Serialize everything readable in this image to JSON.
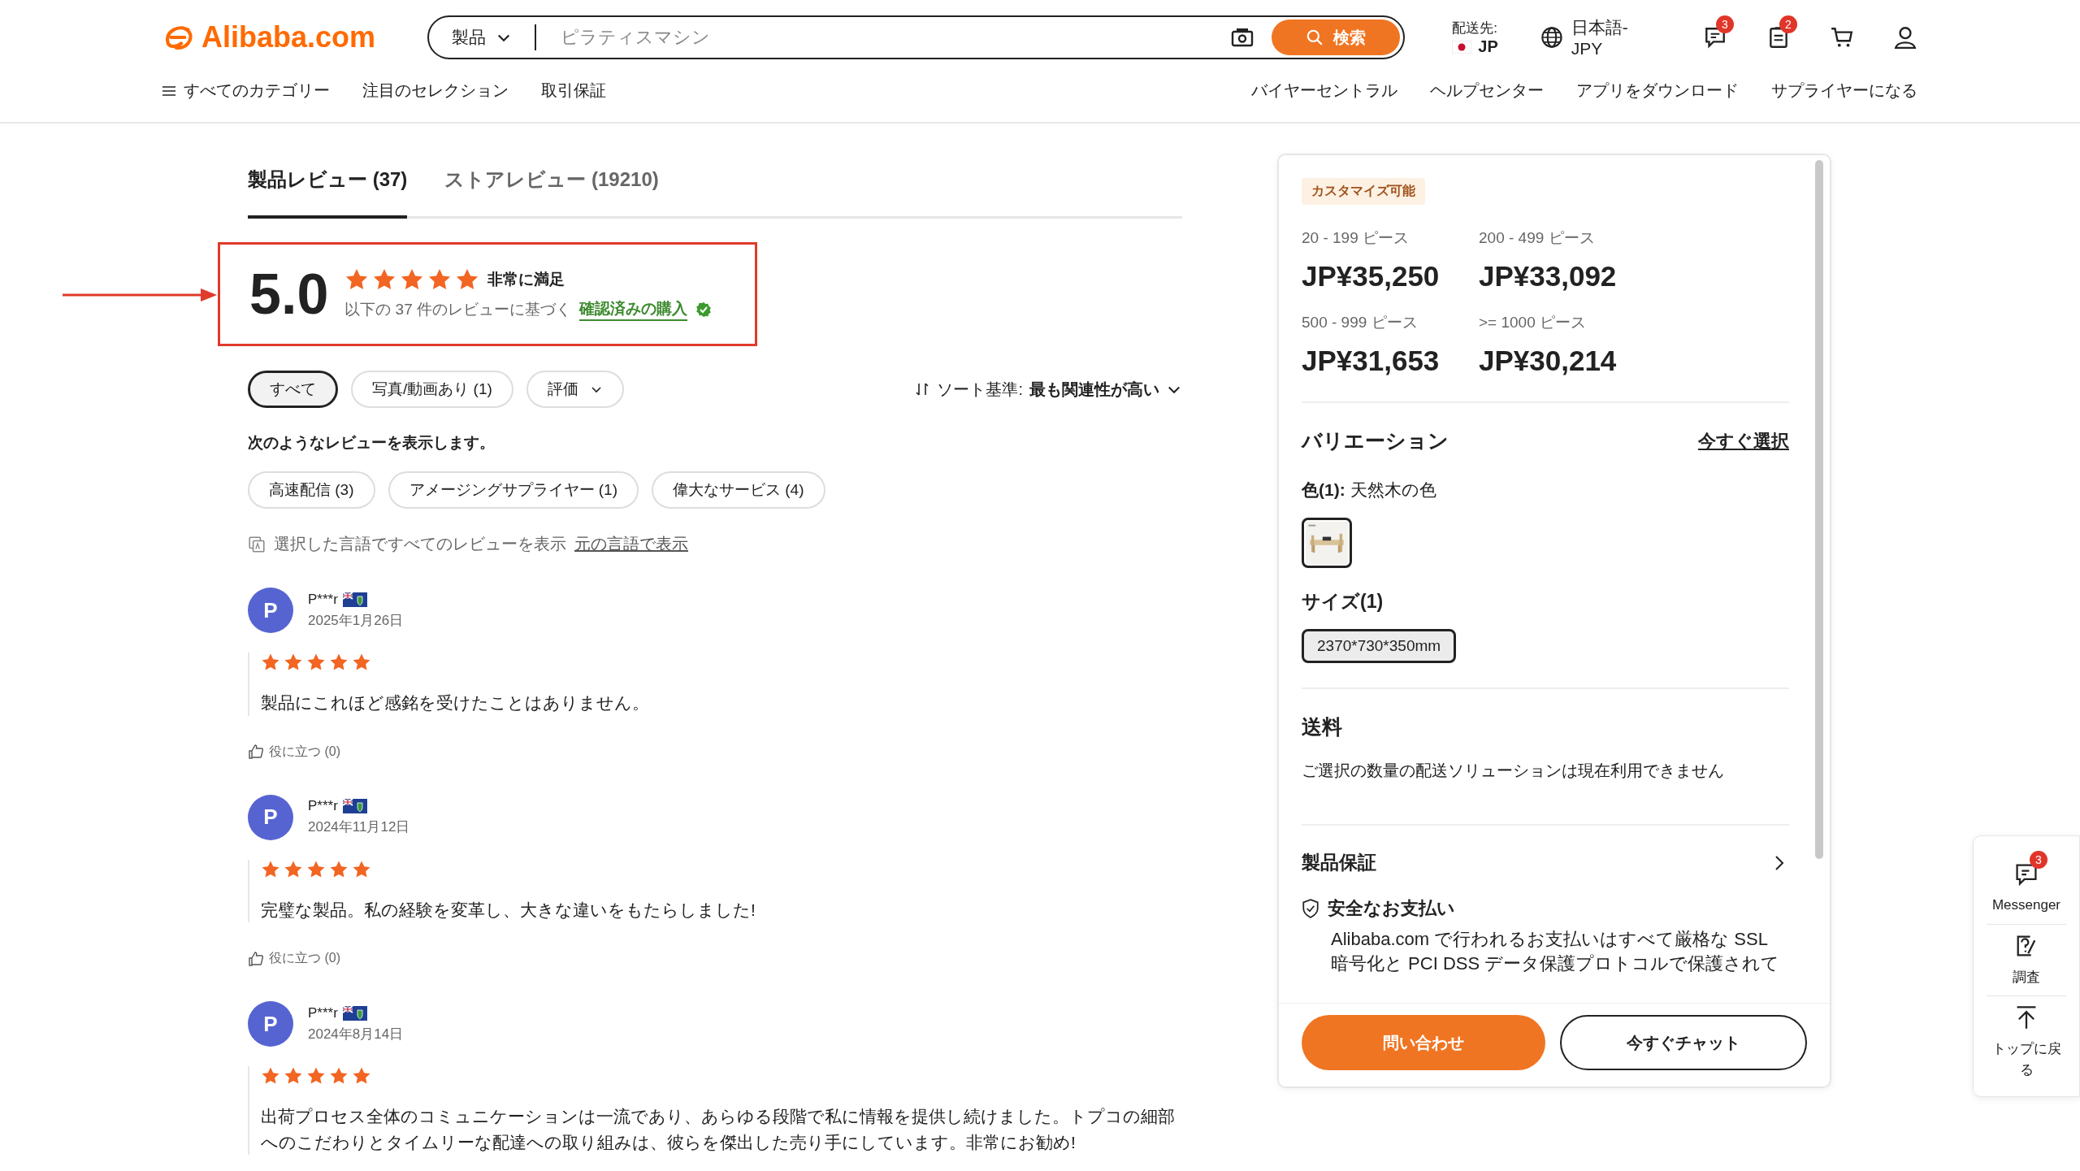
{
  "header": {
    "logo": "Alibaba.com",
    "search": {
      "category": "製品",
      "placeholder": "ピラティスマシン",
      "button": "検索"
    },
    "ship_to": {
      "label": "配送先:",
      "country": "JP"
    },
    "language": "日本語-JPY",
    "message_badge": "3",
    "orders_badge": "2"
  },
  "nav_left": [
    "すべてのカテゴリー",
    "注目のセレクション",
    "取引保証"
  ],
  "nav_right": [
    "バイヤーセントラル",
    "ヘルプセンター",
    "アプリをダウンロード",
    "サプライヤーになる"
  ],
  "tabs": [
    {
      "label": "製品レビュー (37)",
      "selected": true
    },
    {
      "label": "ストアレビュー (19210)",
      "selected": false
    }
  ],
  "rating_summary": {
    "score": "5.0",
    "stars": 5,
    "label": "非常に満足",
    "basis": "以下の 37 件のレビューに基づく",
    "verified": "確認済みの購入"
  },
  "filters": [
    {
      "label": "すべて",
      "selected": true,
      "kind": "chip"
    },
    {
      "label": "写真/動画あり (1)",
      "selected": false,
      "kind": "chip"
    },
    {
      "label": "評価",
      "selected": false,
      "kind": "dropdown"
    }
  ],
  "sort": {
    "label": "ソート基準:",
    "value": "最も関連性が高い"
  },
  "tags_heading": "次のようなレビューを表示します。",
  "tags": [
    "高速配信 (3)",
    "アメージングサプライヤー (1)",
    "偉大なサービス (4)"
  ],
  "translation": {
    "text": "選択した言語ですべてのレビューを表示",
    "link": "元の言語で表示"
  },
  "reviews": [
    {
      "initial": "P",
      "name": "P***r",
      "date": "2025年1月26日",
      "stars": 5,
      "text": "製品にこれほど感銘を受けたことはありません。",
      "helpful": "役に立つ (0)"
    },
    {
      "initial": "P",
      "name": "P***r",
      "date": "2024年11月12日",
      "stars": 5,
      "text": "完璧な製品。私の経験を変革し、大きな違いをもたらしました!",
      "helpful": "役に立つ (0)"
    },
    {
      "initial": "P",
      "name": "P***r",
      "date": "2024年8月14日",
      "stars": 5,
      "text": "出荷プロセス全体のコミュニケーションは一流であり、あらゆる段階で私に情報を提供し続けました。トプコの細部へのこだわりとタイムリーな配達への取り組みは、彼らを傑出した売り手にしています。非常にお勧め!"
    }
  ],
  "panel": {
    "badge": "カスタマイズ可能",
    "tiers": [
      {
        "range": "20 - 199 ピース",
        "price": "JP¥35,250"
      },
      {
        "range": "200 - 499 ピース",
        "price": "JP¥33,092"
      },
      {
        "range": "500 - 999 ピース",
        "price": "JP¥31,653"
      },
      {
        "range": ">= 1000 ピース",
        "price": "JP¥30,214"
      }
    ],
    "variation_title": "バリエーション",
    "select_link": "今すぐ選択",
    "color_label": "色(1):",
    "color_value": "天然木の色",
    "color_options": [
      {
        "selected": true
      }
    ],
    "size_title": "サイズ(1)",
    "sizes": [
      {
        "label": "2370*730*350mm",
        "selected": true
      }
    ],
    "shipping_title": "送料",
    "shipping_text": "ご選択の数量の配送ソリューションは現在利用できません",
    "warranty_title": "製品保証",
    "payment_title": "安全なお支払い",
    "payment_text": "Alibaba.com で行われるお支払いはすべて厳格な SSL 暗号化と PCI DSS データ保護プロトコルで保護されて",
    "contact_button": "問い合わせ",
    "chat_button": "今すぐチャット"
  },
  "side_float": [
    {
      "kind": "messenger",
      "label": "Messenger",
      "badge": "3"
    },
    {
      "kind": "survey",
      "label": "調査"
    },
    {
      "kind": "top",
      "label": "トップに戻る"
    }
  ]
}
